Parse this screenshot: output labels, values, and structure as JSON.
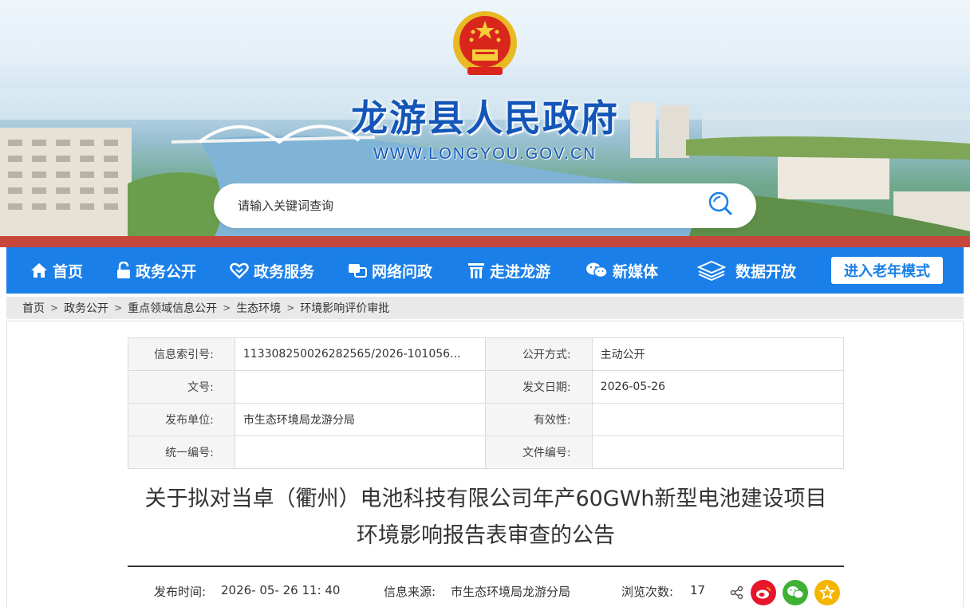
{
  "site": {
    "title": "龙游县人民政府",
    "url": "WWW.LONGYOU.GOV.CN"
  },
  "search": {
    "placeholder": "请输入关键词查询"
  },
  "nav": {
    "items": [
      {
        "label": "首页",
        "icon": "home-icon"
      },
      {
        "label": "政务公开",
        "icon": "lock-icon"
      },
      {
        "label": "政务服务",
        "icon": "service-icon"
      },
      {
        "label": "网络问政",
        "icon": "chat-icon"
      },
      {
        "label": "走进龙游",
        "icon": "gate-icon"
      },
      {
        "label": "新媒体",
        "icon": "wechat-icon"
      },
      {
        "label": "数据开放",
        "icon": "layers-icon"
      }
    ],
    "elder_mode": "进入老年模式"
  },
  "breadcrumb": [
    "首页",
    "政务公开",
    "重点领域信息公开",
    "生态环境",
    "环境影响评价审批"
  ],
  "meta": {
    "index_label": "信息索引号:",
    "index_value": "113308250026282565/2026-101056...",
    "open_label": "公开方式:",
    "open_value": "主动公开",
    "docno_label": "文号:",
    "docno_value": "",
    "date_label": "发文日期:",
    "date_value": "2026-05-26",
    "issuer_label": "发布单位:",
    "issuer_value": "市生态环境局龙游分局",
    "validity_label": "有效性:",
    "validity_value": "",
    "unified_label": "统一编号:",
    "unified_value": "",
    "fileno_label": "文件编号:",
    "fileno_value": ""
  },
  "article": {
    "title_line1": "关于拟对当卓（衢州）电池科技有限公司年产60GWh新型电池建设项目",
    "title_line2": "环境影响报告表审查的公告",
    "publish_label": "发布时间:",
    "publish_time": "2026- 05- 26 11: 40",
    "source_label": "信息来源:",
    "source_value": "市生态环境局龙游分局",
    "views_label": "浏览次数:",
    "views_value": "17"
  },
  "share": {
    "icons": [
      "share-icon",
      "weibo-icon",
      "wechat-icon",
      "favorite-icon"
    ],
    "colors": {
      "weibo": "#e6162d",
      "wechat": "#3eb135",
      "favorite": "#f4b400"
    }
  },
  "colors": {
    "nav_bg": "#1a7fe8",
    "title_blue": "#1456b8"
  }
}
